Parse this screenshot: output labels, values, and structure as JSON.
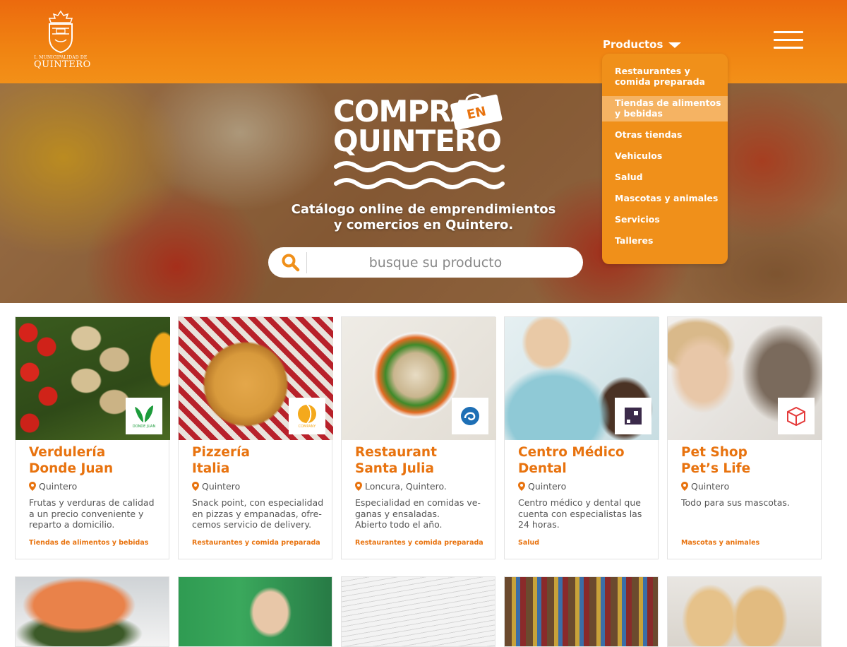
{
  "header": {
    "logo_line_small": "I. MUNICIPALIDAD DE",
    "logo_line_big": "QUINTERO",
    "productos_label": "Productos"
  },
  "hero": {
    "brand_line1": "COMPRA",
    "brand_badge": "EN",
    "brand_line2": "QUINTERO",
    "tagline_line1": "Catálogo online de emprendimientos",
    "tagline_line2": "y comercios en Quintero.",
    "search_placeholder": "busque su producto"
  },
  "dropdown": {
    "items": [
      {
        "line1": "Restaurantes y",
        "line2": "comida preparada"
      },
      {
        "line1": "Tiendas de alimentos",
        "line2": "y bebidas"
      },
      {
        "line1": "Otras tiendas",
        "line2": ""
      },
      {
        "line1": "Vehiculos",
        "line2": ""
      },
      {
        "line1": "Salud",
        "line2": ""
      },
      {
        "line1": "Mascotas y animales",
        "line2": ""
      },
      {
        "line1": "Servicios",
        "line2": ""
      },
      {
        "line1": "Talleres",
        "line2": ""
      }
    ]
  },
  "cards": [
    {
      "title1": "Verdulería",
      "title2": "Donde Juan",
      "location": "Quintero",
      "desc": [
        "Frutas y verduras de calidad",
        "a un precio conveniente y",
        "reparto a domicilio."
      ],
      "category": "Tiendas de alimentos y bebidas",
      "badge_text": "DONDE JUAN",
      "icon": "leaf-icon"
    },
    {
      "title1": "Pizzería",
      "title2": "Italia",
      "location": "Quintero",
      "desc": [
        "Snack point, con especialidad",
        "en pizzas y empanadas, ofre-",
        "cemos servicio de delivery."
      ],
      "category": "Restaurantes y comida preparada",
      "badge_text": "COMPANY",
      "icon": "circle-logo-icon"
    },
    {
      "title1": "Restaurant",
      "title2": "Santa Julia",
      "location": "Loncura, Quintero.",
      "desc": [
        "Especialidad en comidas ve-",
        "ganas y ensaladas.",
        "Abierto todo el año."
      ],
      "category": "Restaurantes y comida preparada",
      "badge_text": "",
      "icon": "spiral-logo-icon"
    },
    {
      "title1": "Centro Médico",
      "title2": "Dental",
      "location": "Quintero",
      "desc": [
        "Centro médico y dental que",
        "cuenta con especialistas las",
        "24 horas."
      ],
      "category": "Salud",
      "badge_text": "",
      "icon": "square-logo-icon"
    },
    {
      "title1": "Pet Shop",
      "title2": "Pet’s Life",
      "location": "Quintero",
      "desc": [
        "Todo para sus mascotas."
      ],
      "category": "Mascotas y animales",
      "badge_text": "",
      "icon": "cube-logo-icon"
    }
  ],
  "colors": {
    "accent_orange": "#e8730f",
    "header_orange": "#ec6a0e",
    "dropdown_orange": "#f0901a"
  }
}
